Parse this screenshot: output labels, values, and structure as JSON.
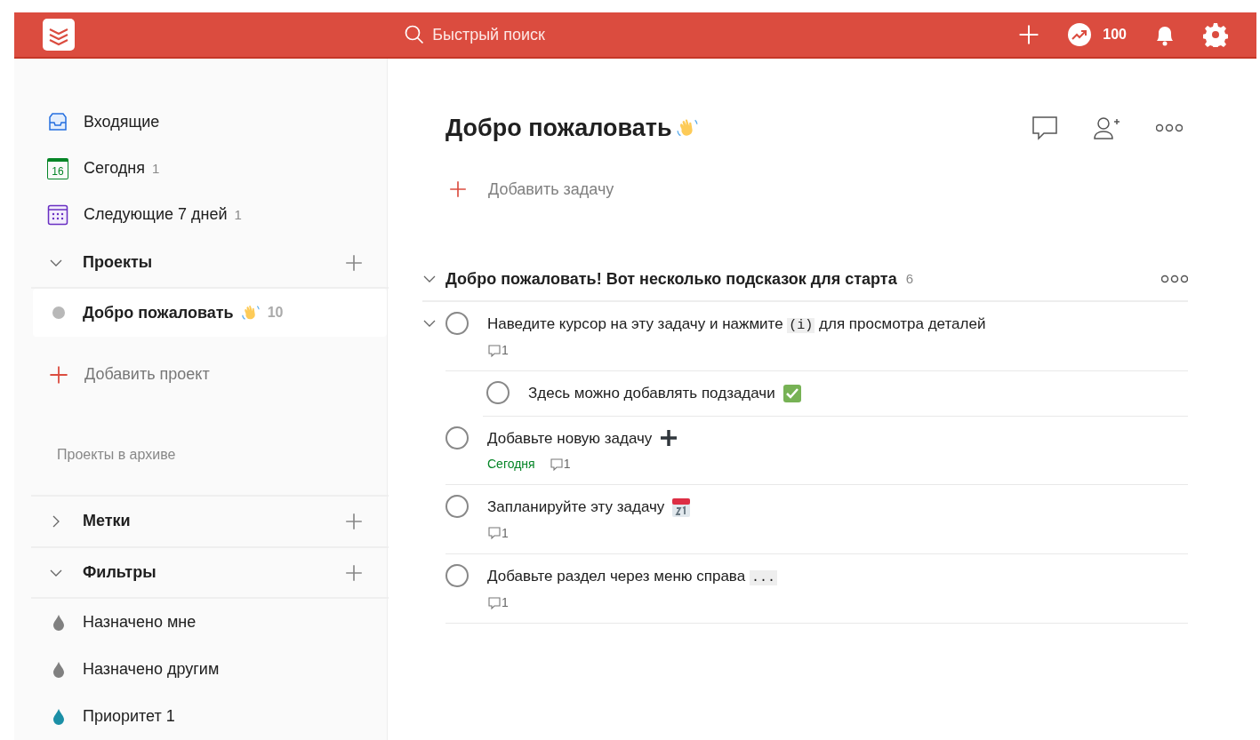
{
  "topbar": {
    "search": {
      "placeholder": "Быстрый поиск"
    },
    "karma": "100"
  },
  "sidebar": {
    "nav": [
      {
        "kind": "inbox",
        "label": "Входящие"
      },
      {
        "kind": "today",
        "label": "Сегодня",
        "count": "1",
        "day": "16"
      },
      {
        "kind": "upcoming",
        "label": "Следующие 7 дней",
        "count": "1"
      }
    ],
    "projects": {
      "title": "Проекты",
      "expanded": true,
      "items": [
        {
          "label": "Добро пожаловать",
          "count": "10",
          "selected": true,
          "color": "#b8b8b8"
        }
      ],
      "add": "Добавить проект",
      "archive": "Проекты в архиве"
    },
    "labels": {
      "title": "Метки",
      "expanded": false
    },
    "filters": {
      "title": "Фильтры",
      "expanded": true,
      "items": [
        {
          "label": "Назначено мне",
          "color": "#808080"
        },
        {
          "label": "Назначено другим",
          "color": "#808080"
        },
        {
          "label": "Приоритет 1",
          "color": "#1b8fa6"
        }
      ]
    }
  },
  "main": {
    "title": "Добро пожаловать",
    "add_task": "Добавить задачу",
    "section": {
      "title": "Добро пожаловать! Вот несколько подсказок для старта",
      "count": "6",
      "expanded": true
    },
    "tasks": [
      {
        "checked": false,
        "parts": [
          {
            "kind": "text",
            "text": "Наведите курсор на эту задачу и нажмите "
          },
          {
            "kind": "code",
            "text": "(i)"
          },
          {
            "kind": "text",
            "text": " для просмотра деталей"
          }
        ],
        "comments": "1",
        "expanded": true,
        "children": [
          {
            "checked": false,
            "parts": [
              {
                "kind": "text",
                "text": "Здесь можно добавлять подзадачи"
              },
              {
                "kind": "check"
              }
            ]
          }
        ]
      },
      {
        "checked": false,
        "parts": [
          {
            "kind": "text",
            "text": "Добавьте новую задачу"
          },
          {
            "kind": "plus"
          }
        ],
        "due": "Сегодня",
        "comments": "1"
      },
      {
        "checked": false,
        "parts": [
          {
            "kind": "text",
            "text": "Запланируйте эту задачу"
          },
          {
            "kind": "calendar"
          }
        ],
        "comments": "1"
      },
      {
        "checked": false,
        "parts": [
          {
            "kind": "text",
            "text": "Добавьте раздел через меню справа "
          },
          {
            "kind": "code",
            "text": "..."
          }
        ],
        "comments": "1"
      }
    ]
  }
}
